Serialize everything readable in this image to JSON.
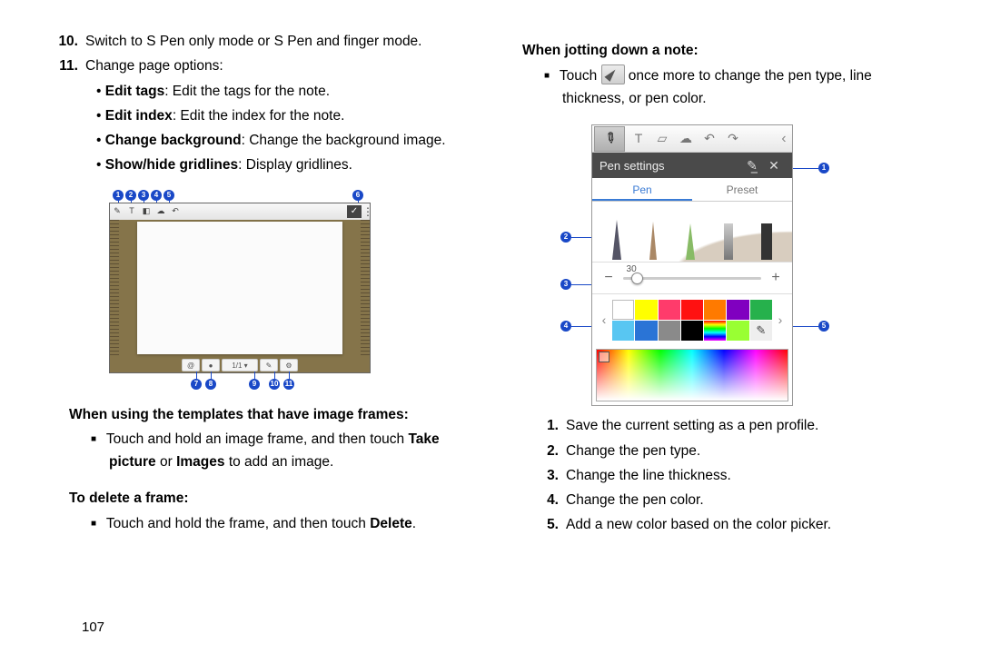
{
  "left": {
    "item10_num": "10.",
    "item10": "Switch to S Pen only mode or S Pen and finger mode.",
    "item11_num": "11.",
    "item11": "Change page options:",
    "sub": {
      "a_b": "Edit tags",
      "a_r": ": Edit the tags for the note.",
      "b_b": "Edit index",
      "b_r": ": Edit the index for the note.",
      "c_b": "Change background",
      "c_r": ": Change the background image.",
      "d_b": "Show/hide gridlines",
      "d_r": ": Display gridlines."
    },
    "h1": "When using the templates that have image frames:",
    "p1a": "Touch and hold an image frame, and then touch ",
    "p1b": "Take picture",
    "p1c": " or ",
    "p1d": "Images",
    "p1e": " to add an image.",
    "h2": "To delete a frame:",
    "p2a": "Touch and hold the frame, and then touch ",
    "p2b": "Delete",
    "p2c": ".",
    "callouts_top": [
      "1",
      "2",
      "3",
      "4",
      "5",
      "6"
    ],
    "callouts_bot": [
      "7",
      "8",
      "9",
      "10",
      "11"
    ]
  },
  "right": {
    "h1": "When jotting down a note:",
    "p1a": "Touch ",
    "p1b": " once more to change the pen type, line thickness, or pen color.",
    "pen_settings_title": "Pen settings",
    "tab_pen": "Pen",
    "tab_preset": "Preset",
    "thick_val": "30",
    "callouts": [
      "1",
      "2",
      "3",
      "4",
      "5"
    ],
    "list": {
      "n1": "1.",
      "t1": "Save the current setting as a pen profile.",
      "n2": "2.",
      "t2": "Change the pen type.",
      "n3": "3.",
      "t3": "Change the line thickness.",
      "n4": "4.",
      "t4": "Change the pen color.",
      "n5": "5.",
      "t5": "Add a new color based on the color picker."
    }
  },
  "swatches": [
    "#ffffff",
    "#ffff00",
    "#ff3b6b",
    "#ff1111",
    "#ff7a00",
    "#8000c0",
    "#26b14c",
    "#58c6f2",
    "#2a74d6",
    "#8a8a8a",
    "#000000",
    "rainbow",
    "#99ff33",
    "eyedrop"
  ],
  "page_number": "107"
}
